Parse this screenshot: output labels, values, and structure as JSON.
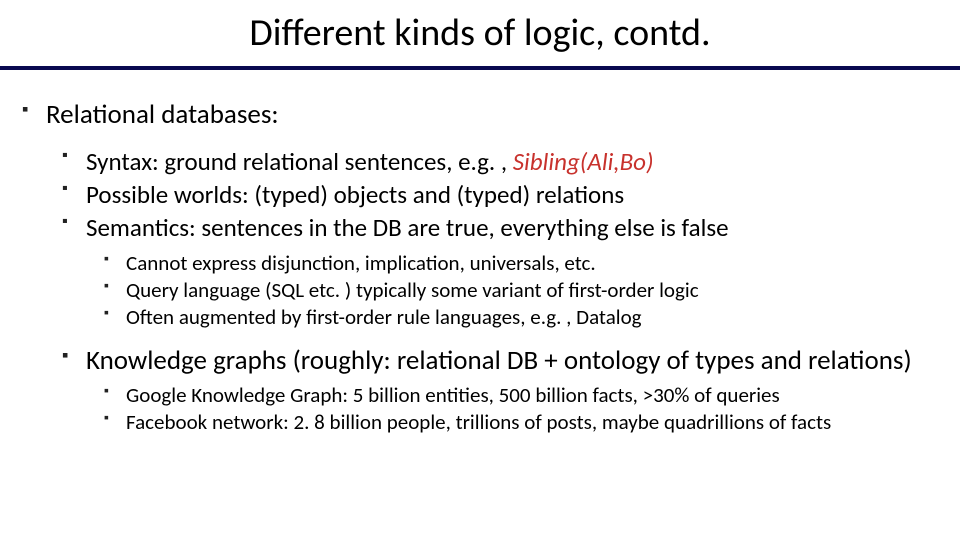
{
  "title": "Different kinds of logic, contd.",
  "l1": {
    "relational": "Relational databases:",
    "kg": "Knowledge graphs (roughly: relational DB + ontology of types and relations)"
  },
  "l2": {
    "syntax_pre": "Syntax: ground relational sentences, e.g. , ",
    "syntax_ex": "Sibling(Ali,Bo)",
    "poss": "Possible worlds: (typed) objects and (typed) relations",
    "sem": "Semantics: sentences in the DB are true, everything else is false"
  },
  "l3a": {
    "a": "Cannot express disjunction, implication, universals, etc.",
    "b": "Query language (SQL etc. ) typically some variant of first-order logic",
    "c": "Often augmented by first-order rule languages, e.g. , Datalog"
  },
  "l3b": {
    "a": "Google Knowledge Graph: 5 billion entities, 500 billion facts, >30% of queries",
    "b": "Facebook network: 2. 8 billion people, trillions of posts, maybe quadrillions of facts"
  }
}
